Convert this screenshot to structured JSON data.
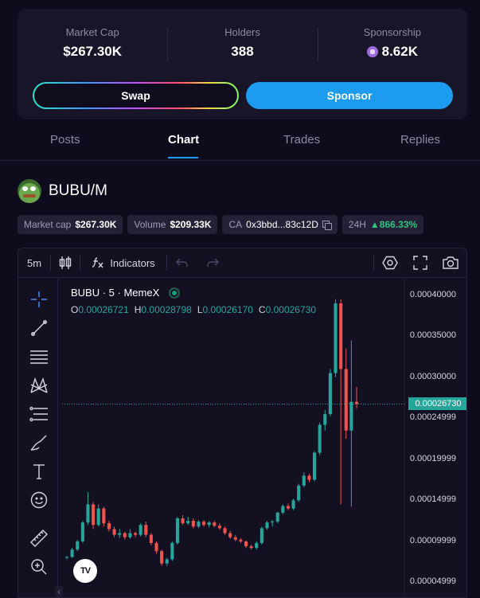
{
  "stats": [
    {
      "label": "Market Cap",
      "value": "$267.30K"
    },
    {
      "label": "Holders",
      "value": "388"
    },
    {
      "label": "Sponsorship",
      "value": "8.62K",
      "icon": "sponsor-coin-icon"
    }
  ],
  "actions": {
    "swap_label": "Swap",
    "sponsor_label": "Sponsor"
  },
  "tabs": [
    {
      "label": "Posts",
      "active": false
    },
    {
      "label": "Chart",
      "active": true
    },
    {
      "label": "Trades",
      "active": false
    },
    {
      "label": "Replies",
      "active": false
    }
  ],
  "token": {
    "name": "BUBU/M",
    "avatar_icon": "pepe-avatar-icon"
  },
  "chips": {
    "market_cap": {
      "label": "Market cap",
      "value": "$267.30K"
    },
    "volume": {
      "label": "Volume",
      "value": "$209.33K"
    },
    "ca": {
      "label": "CA",
      "value": "0x3bbd...83c12D"
    },
    "change": {
      "label": "24H",
      "value": "866.33%",
      "arrow": "▲"
    }
  },
  "toolbar": {
    "interval": "5m",
    "indicators_label": "Indicators"
  },
  "chart_header": {
    "symbol": "BUBU · 5 · MemeX",
    "ohlc": {
      "o_label": "O",
      "o": "0.00026721",
      "h_label": "H",
      "h": "0.00028798",
      "l_label": "L",
      "l": "0.00026170",
      "c_label": "C",
      "c": "0.00026730"
    }
  },
  "colors": {
    "up": "#26a69a",
    "down": "#ef5350",
    "accent": "#1d9bf0"
  },
  "chart_data": {
    "type": "candlestick",
    "ylim": [
      3e-05,
      0.00042
    ],
    "y_ticks": [
      "0.00040000",
      "0.00035000",
      "0.00030000",
      "0.00024999",
      "0.00019999",
      "0.00014999",
      "0.00009999",
      "0.00004999"
    ],
    "y_tick_values": [
      0.0004,
      0.00035,
      0.0003,
      0.00025,
      0.0002,
      0.00015,
      0.0001,
      5e-05
    ],
    "last_price": "0.00026730",
    "last_price_value": 0.0002673,
    "candles": [
      {
        "o": 8e-05,
        "h": 8.2e-05,
        "l": 7.8e-05,
        "c": 8.1e-05
      },
      {
        "o": 8.1e-05,
        "h": 9.2e-05,
        "l": 8e-05,
        "c": 9e-05
      },
      {
        "o": 9e-05,
        "h": 0.000102,
        "l": 8.8e-05,
        "c": 0.0001
      },
      {
        "o": 0.0001,
        "h": 0.000125,
        "l": 9.8e-05,
        "c": 0.000123
      },
      {
        "o": 0.000123,
        "h": 0.00016,
        "l": 0.00012,
        "c": 0.000145
      },
      {
        "o": 0.000145,
        "h": 0.000148,
        "l": 0.000115,
        "c": 0.00012
      },
      {
        "o": 0.00012,
        "h": 0.000145,
        "l": 0.000118,
        "c": 0.00014
      },
      {
        "o": 0.00014,
        "h": 0.000142,
        "l": 0.000118,
        "c": 0.000122
      },
      {
        "o": 0.000122,
        "h": 0.000125,
        "l": 0.000112,
        "c": 0.000115
      },
      {
        "o": 0.000115,
        "h": 0.000118,
        "l": 0.000105,
        "c": 0.000108
      },
      {
        "o": 0.000108,
        "h": 0.000115,
        "l": 0.000104,
        "c": 0.00011
      },
      {
        "o": 0.00011,
        "h": 0.000112,
        "l": 0.000102,
        "c": 0.000105
      },
      {
        "o": 0.000105,
        "h": 0.000115,
        "l": 0.000103,
        "c": 0.00011
      },
      {
        "o": 0.00011,
        "h": 0.000112,
        "l": 0.000105,
        "c": 0.000108
      },
      {
        "o": 0.000108,
        "h": 0.000122,
        "l": 0.000106,
        "c": 0.00012
      },
      {
        "o": 0.00012,
        "h": 0.000124,
        "l": 0.000105,
        "c": 0.000108
      },
      {
        "o": 0.000108,
        "h": 0.00011,
        "l": 9.5e-05,
        "c": 9.8e-05
      },
      {
        "o": 9.8e-05,
        "h": 0.0001,
        "l": 8.5e-05,
        "c": 8.8e-05
      },
      {
        "o": 8.8e-05,
        "h": 9e-05,
        "l": 7e-05,
        "c": 7.3e-05
      },
      {
        "o": 7.3e-05,
        "h": 8e-05,
        "l": 7e-05,
        "c": 7.8e-05
      },
      {
        "o": 7.8e-05,
        "h": 0.0001,
        "l": 7.6e-05,
        "c": 9.8e-05
      },
      {
        "o": 9.8e-05,
        "h": 0.00013,
        "l": 9.6e-05,
        "c": 0.000128
      },
      {
        "o": 0.000128,
        "h": 0.000132,
        "l": 0.00012,
        "c": 0.000122
      },
      {
        "o": 0.000122,
        "h": 0.00013,
        "l": 0.00012,
        "c": 0.000125
      },
      {
        "o": 0.000125,
        "h": 0.000128,
        "l": 0.000116,
        "c": 0.000118
      },
      {
        "o": 0.000118,
        "h": 0.000126,
        "l": 0.000116,
        "c": 0.000124
      },
      {
        "o": 0.000124,
        "h": 0.000126,
        "l": 0.000118,
        "c": 0.00012
      },
      {
        "o": 0.00012,
        "h": 0.000125,
        "l": 0.000117,
        "c": 0.000123
      },
      {
        "o": 0.000123,
        "h": 0.000125,
        "l": 0.000117,
        "c": 0.000119
      },
      {
        "o": 0.000119,
        "h": 0.000122,
        "l": 0.000114,
        "c": 0.000116
      },
      {
        "o": 0.000116,
        "h": 0.000118,
        "l": 0.000108,
        "c": 0.00011
      },
      {
        "o": 0.00011,
        "h": 0.000113,
        "l": 0.000103,
        "c": 0.000105
      },
      {
        "o": 0.000105,
        "h": 0.000108,
        "l": 0.0001,
        "c": 0.000102
      },
      {
        "o": 0.000102,
        "h": 0.000104,
        "l": 9.8e-05,
        "c": 0.0001
      },
      {
        "o": 0.0001,
        "h": 0.000101,
        "l": 9.2e-05,
        "c": 9.4e-05
      },
      {
        "o": 9.4e-05,
        "h": 9.6e-05,
        "l": 9e-05,
        "c": 9.2e-05
      },
      {
        "o": 9.2e-05,
        "h": 0.0001,
        "l": 9e-05,
        "c": 9.8e-05
      },
      {
        "o": 9.8e-05,
        "h": 0.000118,
        "l": 9.6e-05,
        "c": 0.000116
      },
      {
        "o": 0.000116,
        "h": 0.000125,
        "l": 0.000114,
        "c": 0.000123
      },
      {
        "o": 0.000123,
        "h": 0.000126,
        "l": 0.000118,
        "c": 0.000124
      },
      {
        "o": 0.000124,
        "h": 0.000136,
        "l": 0.000122,
        "c": 0.000135
      },
      {
        "o": 0.000135,
        "h": 0.000145,
        "l": 0.000133,
        "c": 0.000143
      },
      {
        "o": 0.000143,
        "h": 0.000146,
        "l": 0.000138,
        "c": 0.00014
      },
      {
        "o": 0.00014,
        "h": 0.000152,
        "l": 0.000138,
        "c": 0.00015
      },
      {
        "o": 0.00015,
        "h": 0.00017,
        "l": 0.000148,
        "c": 0.000168
      },
      {
        "o": 0.000168,
        "h": 0.000184,
        "l": 0.000166,
        "c": 0.00018
      },
      {
        "o": 0.00018,
        "h": 0.000182,
        "l": 0.000172,
        "c": 0.000175
      },
      {
        "o": 0.000175,
        "h": 0.00021,
        "l": 0.000173,
        "c": 0.000208
      },
      {
        "o": 0.000208,
        "h": 0.000245,
        "l": 0.000205,
        "c": 0.000242
      },
      {
        "o": 0.000242,
        "h": 0.00026,
        "l": 0.000235,
        "c": 0.000255
      },
      {
        "o": 0.000255,
        "h": 0.00031,
        "l": 0.000252,
        "c": 0.000305
      },
      {
        "o": 0.000305,
        "h": 0.000395,
        "l": 0.0003,
        "c": 0.00039
      },
      {
        "o": 0.00039,
        "h": 0.000395,
        "l": 0.000145,
        "c": 0.00031
      },
      {
        "o": 0.00031,
        "h": 0.000335,
        "l": 0.000225,
        "c": 0.000235
      },
      {
        "o": 0.000235,
        "h": 0.000345,
        "l": 0.000142,
        "c": 0.00027
      },
      {
        "o": 0.00027,
        "h": 0.000288,
        "l": 0.000262,
        "c": 0.0002673
      }
    ]
  }
}
